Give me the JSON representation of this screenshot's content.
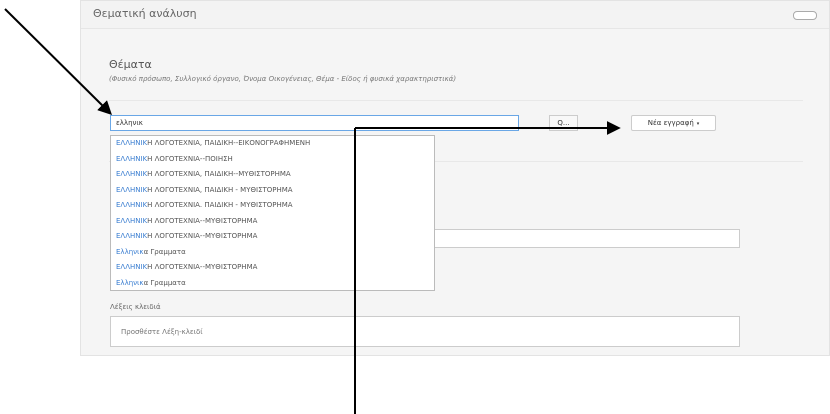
{
  "panel": {
    "title": "Θεματική ανάλυση"
  },
  "subjects": {
    "title": "Θέματα",
    "hint": "(Φυσικό πρόσωπο, Συλλογικό όργανο, Όνομα Οικογένειας, Θέμα - Είδος ή φυσικά χαρακτηριστικά)",
    "search_value": "ελληνικ",
    "search_button_label": "Q...",
    "new_entry_label": "Νέα εγγραφή",
    "caret": "▾"
  },
  "suggestions": [
    {
      "match": "ΕΛΛΗΝΙΚ",
      "rest": "Η ΛΟΓΟΤΕΧΝΙΑ, ΠΑΙΔΙΚΗ--ΕΙΚΟΝΟΓΡΑΦΗΜΕΝΗ"
    },
    {
      "match": "ΕΛΛΗΝΙΚ",
      "rest": "Η ΛΟΓΟΤΕΧΝΙΑ--ΠΟΙΗΣΗ"
    },
    {
      "match": "ΕΛΛΗΝΙΚ",
      "rest": "Η ΛΟΓΟΤΕΧΝΙΑ, ΠΑΙΔΙΚΗ--ΜΥΘΙΣΤΟΡΗΜΑ"
    },
    {
      "match": "ΕΛΛΗΝΙΚ",
      "rest": "Η ΛΟΓΟΤΕΧΝΙΑ, ΠΑΙΔΙΚΗ - ΜΥΘΙΣΤΟΡΗΜΑ"
    },
    {
      "match": "ΕΛΛΗΝΙΚ",
      "rest": "Η ΛΟΓΟΤΕΧΝΙΑ. ΠΑΙΔΙΚΗ - ΜΥΘΙΣΤΟΡΗΜΑ"
    },
    {
      "match": "ΕΛΛΗΝΙΚ",
      "rest": "Η ΛΟΓΟΤΕΧΝΙΑ--ΜΥΘΙΣΤΟΡΗΜΑ"
    },
    {
      "match": "ΕΛΛΗΝΙΚ",
      "rest": "Η ΛΟΓΟΤΕΧΝΙΑ--ΜΥΘΙΣΤΟΡΗΜΑ"
    },
    {
      "match": "Ελληνικ",
      "rest": "α Γραμματα"
    },
    {
      "match": "ΕΛΛΗΝΙΚ",
      "rest": "Η ΛΟΓΟΤΕΧΝΙΑ--ΜΥΘΙΣΤΟΡΗΜΑ"
    },
    {
      "match": "Ελληνικ",
      "rest": "α Γραμματα"
    }
  ],
  "keywords": {
    "label": "Λέξεις κλειδιά",
    "placeholder": "Προσθέστε Λέξη-κλειδί"
  },
  "colors": {
    "highlight": "#3a7ed1",
    "focus_border": "#6aa7e6",
    "annotation": "#000000"
  }
}
